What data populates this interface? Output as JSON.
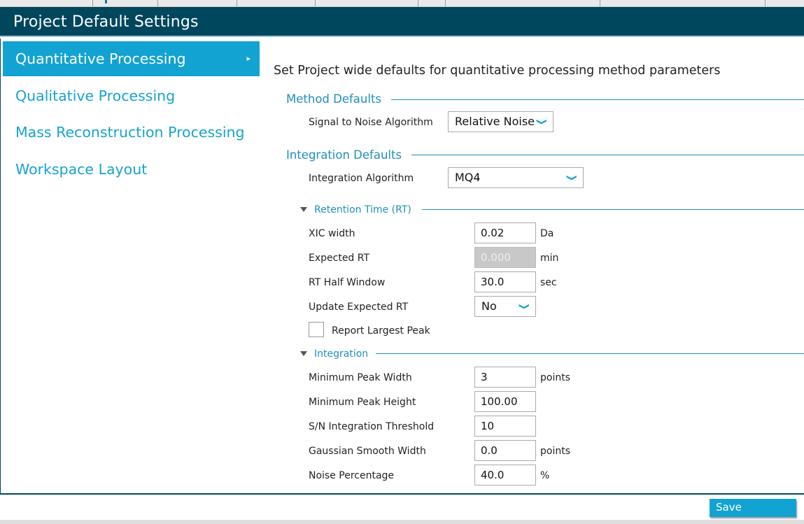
{
  "dialog": {
    "title": "Project Default Settings"
  },
  "nav": {
    "items": [
      {
        "label": "Quantitative Processing",
        "active": true,
        "arrow": "▸"
      },
      {
        "label": "Qualitative Processing",
        "active": false
      },
      {
        "label": "Mass Reconstruction Processing",
        "active": false
      },
      {
        "label": "Workspace Layout",
        "active": false
      }
    ]
  },
  "main": {
    "heading": "Set Project wide defaults for quantitative processing method parameters",
    "method_defaults": {
      "title": "Method Defaults",
      "signal_to_noise": {
        "label": "Signal to Noise Algorithm",
        "value": "Relative Noise"
      }
    },
    "integration_defaults": {
      "title": "Integration Defaults",
      "integration_algorithm": {
        "label": "Integration Algorithm",
        "value": "MQ4"
      },
      "retention_time": {
        "title": "Retention Time (RT)",
        "xic_width": {
          "label": "XIC width",
          "value": "0.02",
          "unit": "Da"
        },
        "expected_rt": {
          "label": "Expected RT",
          "value": "0.000",
          "unit": "min",
          "disabled": true
        },
        "rt_half_window": {
          "label": "RT Half Window",
          "value": "30.0",
          "unit": "sec"
        },
        "update_expected_rt": {
          "label": "Update Expected RT",
          "value": "No"
        },
        "report_largest_peak": {
          "label": "Report Largest Peak",
          "checked": false
        }
      },
      "integration": {
        "title": "Integration",
        "min_peak_width": {
          "label": "Minimum Peak Width",
          "value": "3",
          "unit": "points"
        },
        "min_peak_height": {
          "label": "Minimum Peak Height",
          "value": "100.00"
        },
        "sn_threshold": {
          "label": "S/N Integration Threshold",
          "value": "10"
        },
        "gaussian_smooth_width": {
          "label": "Gaussian Smooth Width",
          "value": "0.0",
          "unit": "points"
        },
        "noise_percentage": {
          "label": "Noise Percentage",
          "value": "40.0",
          "unit": "%"
        }
      }
    }
  },
  "footer": {
    "save_label": "Save"
  },
  "colors": {
    "title_bar": "#00475e",
    "accent": "#12a3d2",
    "section": "#1f8fbf"
  },
  "icons": {
    "dropdown": "chevron-down-icon",
    "expand": "triangle-down-icon",
    "nav_arrow": "chevron-right-icon"
  }
}
